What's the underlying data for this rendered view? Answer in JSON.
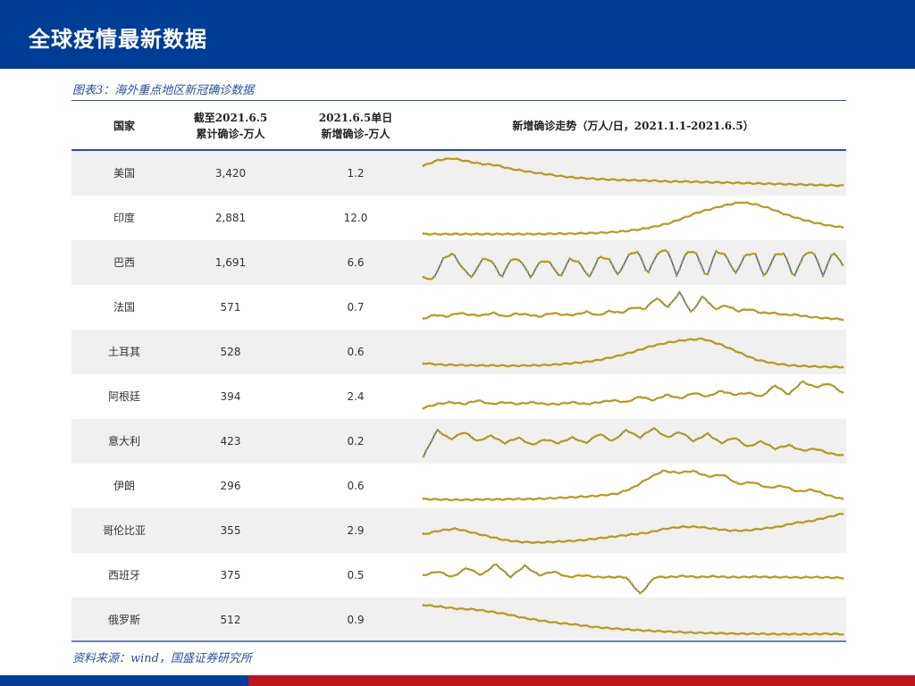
{
  "header": {
    "title": "全球疫情最新数据"
  },
  "caption": "图表3：海外重点地区新冠确诊数据",
  "table": {
    "columns": [
      "国家",
      "截至2021.6.5\n累计确诊-万人",
      "2021.6.5单日\n新增确诊-万人",
      "新增确诊走势（万人/日，2021.1.1-2021.6.5）"
    ],
    "col_country": "国家",
    "col_cum_1": "截至2021.6.5",
    "col_cum_2": "累计确诊-万人",
    "col_new_1": "2021.6.5单日",
    "col_new_2": "新增确诊-万人",
    "col_trend": "新增确诊走势（万人/日，2021.1.1-2021.6.5）",
    "rows": [
      {
        "country": "美国",
        "cumulative": "3,420",
        "new": "1.2"
      },
      {
        "country": "印度",
        "cumulative": "2,881",
        "new": "12.0"
      },
      {
        "country": "巴西",
        "cumulative": "1,691",
        "new": "6.6"
      },
      {
        "country": "法国",
        "cumulative": "571",
        "new": "0.7"
      },
      {
        "country": "土耳其",
        "cumulative": "528",
        "new": "0.6"
      },
      {
        "country": "阿根廷",
        "cumulative": "394",
        "new": "2.4"
      },
      {
        "country": "意大利",
        "cumulative": "423",
        "new": "0.2"
      },
      {
        "country": "伊朗",
        "cumulative": "296",
        "new": "0.6"
      },
      {
        "country": "哥伦比亚",
        "cumulative": "355",
        "new": "2.9"
      },
      {
        "country": "西班牙",
        "cumulative": "375",
        "new": "0.5"
      },
      {
        "country": "俄罗斯",
        "cumulative": "512",
        "new": "0.9"
      }
    ]
  },
  "chart_data": {
    "type": "line",
    "note": "relative trend per country, normalized 0-1",
    "colors": {
      "line": "#3a6fb5",
      "marker": "#c9a100"
    },
    "series": [
      {
        "name": "美国",
        "values": [
          0.7,
          0.85,
          0.9,
          0.82,
          0.75,
          0.72,
          0.62,
          0.56,
          0.5,
          0.45,
          0.4,
          0.37,
          0.35,
          0.33,
          0.32,
          0.31,
          0.3,
          0.28,
          0.28,
          0.27,
          0.26,
          0.25,
          0.24,
          0.23,
          0.22,
          0.21,
          0.2,
          0.19,
          0.18,
          0.17
        ]
      },
      {
        "name": "印度",
        "values": [
          0.07,
          0.07,
          0.07,
          0.07,
          0.07,
          0.07,
          0.07,
          0.07,
          0.07,
          0.08,
          0.08,
          0.09,
          0.1,
          0.12,
          0.15,
          0.2,
          0.27,
          0.36,
          0.5,
          0.65,
          0.75,
          0.85,
          0.92,
          0.86,
          0.75,
          0.6,
          0.48,
          0.38,
          0.3,
          0.25
        ]
      },
      {
        "name": "巴西",
        "values": [
          0.1,
          0.05,
          0.6,
          0.75,
          0.35,
          0.1,
          0.6,
          0.55,
          0.1,
          0.6,
          0.55,
          0.1,
          0.55,
          0.5,
          0.1,
          0.6,
          0.5,
          0.1,
          0.65,
          0.6,
          0.15,
          0.7,
          0.8,
          0.2,
          0.75,
          0.85,
          0.15,
          0.8,
          0.75,
          0.1,
          0.8,
          0.7,
          0.2,
          0.7,
          0.75,
          0.1,
          0.7,
          0.75,
          0.1,
          0.7,
          0.8,
          0.15,
          0.8,
          0.45
        ]
      },
      {
        "name": "法国",
        "values": [
          0.2,
          0.3,
          0.25,
          0.35,
          0.3,
          0.28,
          0.35,
          0.25,
          0.33,
          0.3,
          0.25,
          0.35,
          0.3,
          0.3,
          0.38,
          0.28,
          0.4,
          0.35,
          0.5,
          0.45,
          0.75,
          0.5,
          0.9,
          0.35,
          0.8,
          0.45,
          0.55,
          0.4,
          0.45,
          0.35,
          0.35,
          0.3,
          0.3,
          0.25,
          0.22,
          0.2,
          0.18
        ]
      },
      {
        "name": "土耳其",
        "values": [
          0.2,
          0.16,
          0.15,
          0.14,
          0.14,
          0.13,
          0.14,
          0.15,
          0.18,
          0.22,
          0.28,
          0.38,
          0.5,
          0.65,
          0.75,
          0.82,
          0.85,
          0.7,
          0.5,
          0.3,
          0.2,
          0.14,
          0.12,
          0.1,
          0.1
        ]
      },
      {
        "name": "阿根廷",
        "values": [
          0.2,
          0.3,
          0.35,
          0.3,
          0.4,
          0.3,
          0.35,
          0.3,
          0.35,
          0.3,
          0.3,
          0.35,
          0.3,
          0.35,
          0.4,
          0.35,
          0.5,
          0.4,
          0.55,
          0.45,
          0.6,
          0.5,
          0.65,
          0.55,
          0.6,
          0.5,
          0.8,
          0.55,
          0.9,
          0.75,
          0.85,
          0.6
        ]
      },
      {
        "name": "意大利",
        "values": [
          0.1,
          0.8,
          0.55,
          0.75,
          0.5,
          0.65,
          0.45,
          0.6,
          0.4,
          0.55,
          0.45,
          0.6,
          0.45,
          0.7,
          0.5,
          0.8,
          0.6,
          0.85,
          0.6,
          0.75,
          0.5,
          0.7,
          0.45,
          0.6,
          0.35,
          0.5,
          0.3,
          0.4,
          0.25,
          0.3,
          0.18,
          0.12
        ]
      },
      {
        "name": "伊朗",
        "values": [
          0.15,
          0.14,
          0.13,
          0.13,
          0.14,
          0.14,
          0.15,
          0.15,
          0.16,
          0.18,
          0.2,
          0.22,
          0.25,
          0.3,
          0.45,
          0.7,
          0.9,
          0.85,
          0.9,
          0.75,
          0.8,
          0.55,
          0.6,
          0.45,
          0.5,
          0.35,
          0.4,
          0.25,
          0.15
        ]
      },
      {
        "name": "哥伦比亚",
        "values": [
          0.4,
          0.5,
          0.55,
          0.45,
          0.35,
          0.25,
          0.2,
          0.18,
          0.2,
          0.22,
          0.25,
          0.3,
          0.35,
          0.4,
          0.45,
          0.55,
          0.6,
          0.6,
          0.55,
          0.5,
          0.5,
          0.55,
          0.6,
          0.7,
          0.75,
          0.85,
          0.95
        ]
      },
      {
        "name": "西班牙",
        "values": [
          0.5,
          0.6,
          0.45,
          0.7,
          0.5,
          0.8,
          0.45,
          0.75,
          0.5,
          0.6,
          0.45,
          0.5,
          0.45,
          0.45,
          0.45,
          0.0,
          0.45,
          0.45,
          0.48,
          0.45,
          0.47,
          0.45,
          0.45,
          0.46,
          0.45,
          0.45,
          0.44,
          0.45,
          0.44,
          0.43
        ]
      },
      {
        "name": "俄罗斯",
        "values": [
          0.9,
          0.85,
          0.8,
          0.78,
          0.72,
          0.65,
          0.55,
          0.48,
          0.42,
          0.38,
          0.32,
          0.28,
          0.25,
          0.22,
          0.2,
          0.18,
          0.16,
          0.15,
          0.14,
          0.13,
          0.13,
          0.12,
          0.12,
          0.12,
          0.13,
          0.12
        ]
      }
    ]
  },
  "footer": {
    "source": "资料来源：wind，国盛证券研究所"
  }
}
